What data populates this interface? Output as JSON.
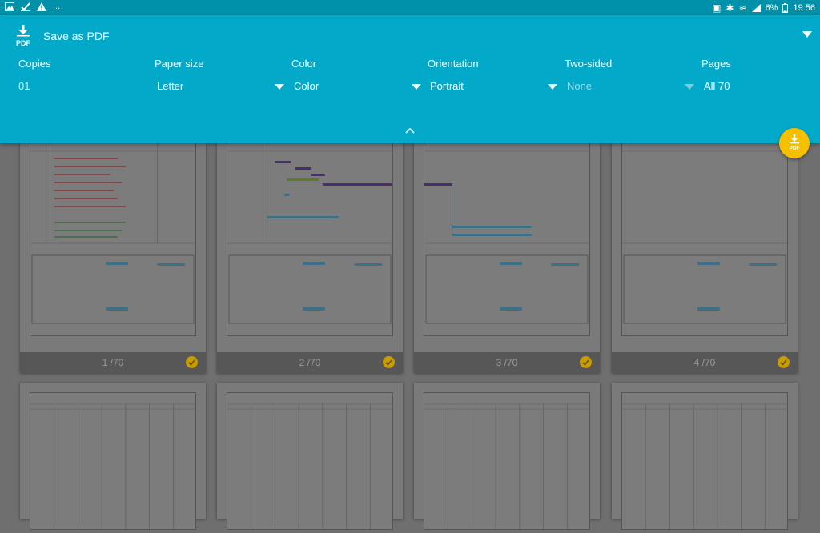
{
  "status_bar": {
    "battery": "6%",
    "time": "19:56",
    "left_icons": [
      "image-icon",
      "check-icon",
      "warning-icon",
      "more-icon"
    ],
    "more": "..."
  },
  "print_panel": {
    "title": "Save as PDF",
    "pdf_icon_text": "PDF",
    "options": [
      {
        "label": "Copies",
        "value": "01",
        "enabled": true,
        "has_dropdown": false
      },
      {
        "label": "Paper size",
        "value": "Letter",
        "enabled": true,
        "has_dropdown": true
      },
      {
        "label": "Color",
        "value": "Color",
        "enabled": true,
        "has_dropdown": true
      },
      {
        "label": "Orientation",
        "value": "Portrait",
        "enabled": true,
        "has_dropdown": true
      },
      {
        "label": "Two-sided",
        "value": "None",
        "enabled": false,
        "has_dropdown": true
      },
      {
        "label": "Pages",
        "value": "All 70",
        "enabled": true,
        "has_dropdown": true
      }
    ]
  },
  "fab": {
    "label": "PDF"
  },
  "thumbnails": [
    {
      "label": "1 /70",
      "selected": true
    },
    {
      "label": "2 /70",
      "selected": true
    },
    {
      "label": "3 /70",
      "selected": true
    },
    {
      "label": "4 /70",
      "selected": true
    }
  ],
  "colors": {
    "panel": "#02a9c8",
    "status_bar": "#0091aa",
    "fab": "#f6c000",
    "check": "#c99c00"
  }
}
